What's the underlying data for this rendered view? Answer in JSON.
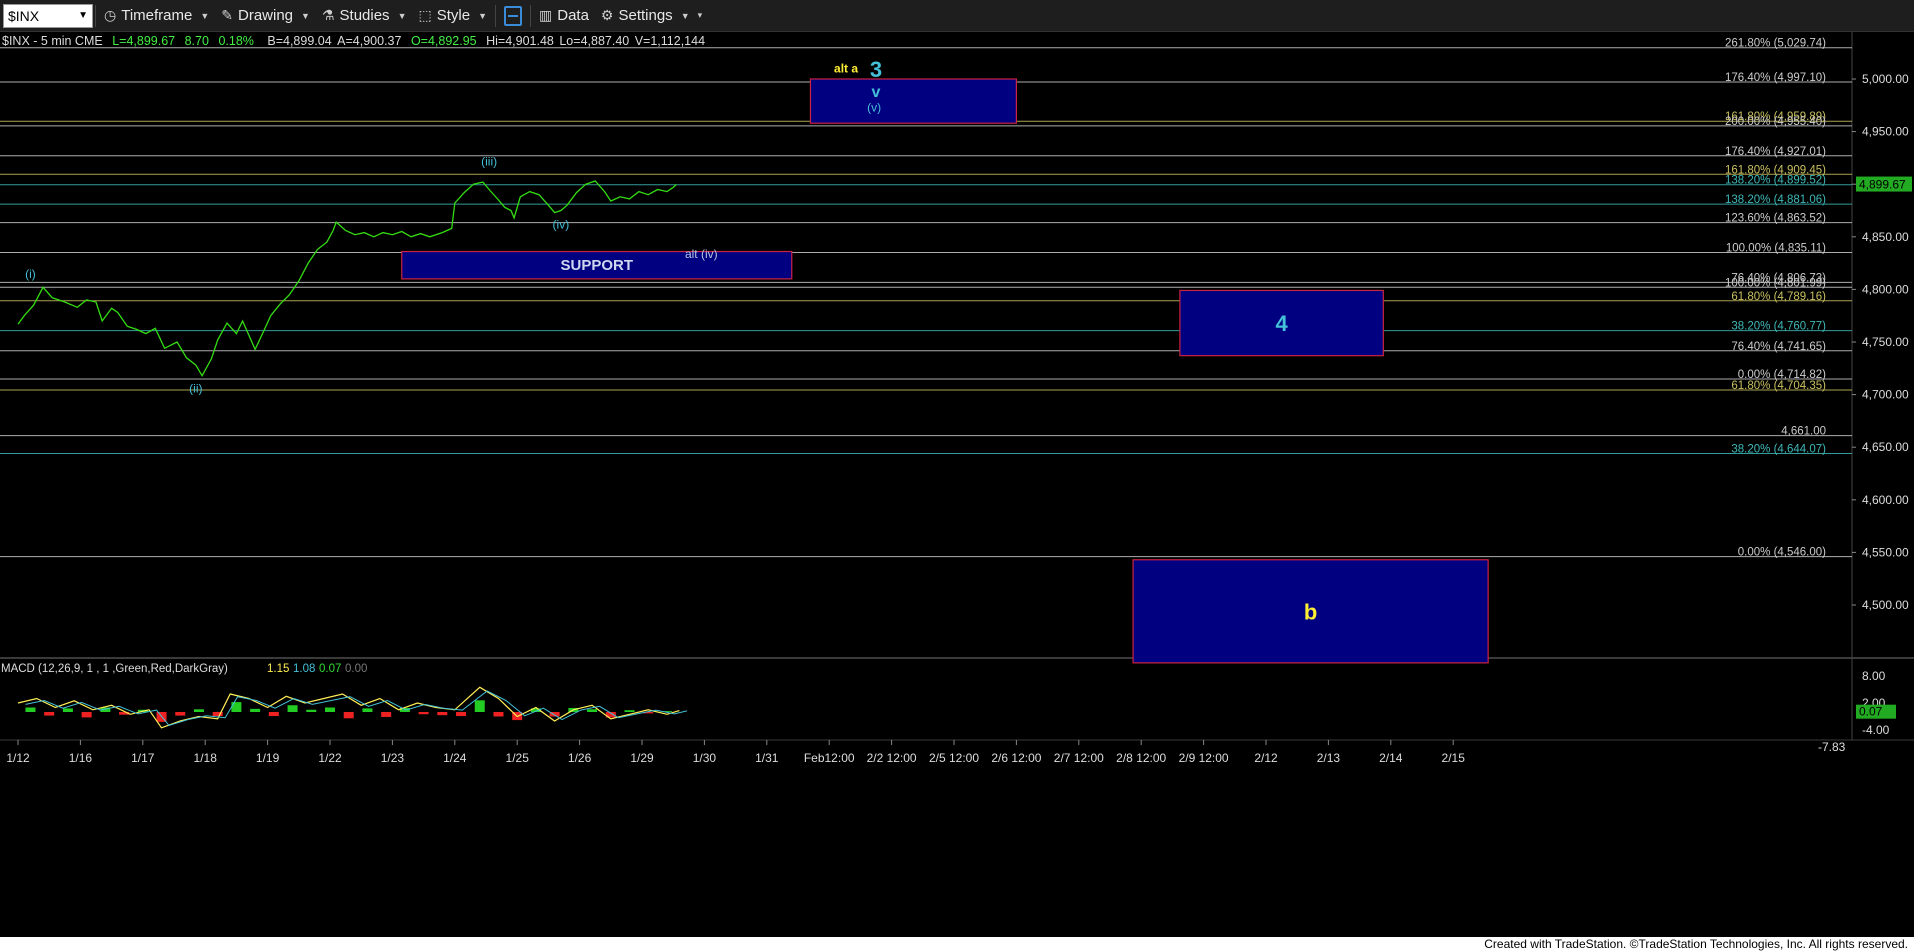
{
  "toolbar": {
    "symbol": "$INX",
    "items": [
      {
        "label": "Timeframe",
        "icon": "clock-icon"
      },
      {
        "label": "Drawing",
        "icon": "pencil-icon"
      },
      {
        "label": "Studies",
        "icon": "flask-icon"
      },
      {
        "label": "Style",
        "icon": "style-icon"
      },
      {
        "label": "Data",
        "icon": "bar-chart-icon"
      },
      {
        "label": "Settings",
        "icon": "gear-icon"
      }
    ]
  },
  "ticker_line": {
    "name": "$INX - 5 min  CME",
    "last": "L=4,899.67",
    "change": "8.70",
    "pct": "0.18%",
    "bid": "B=4,899.04",
    "ask": "A=4,900.37",
    "open": "O=4,892.95",
    "high": "Hi=4,901.48",
    "low": "Lo=4,887.40",
    "volume": "V=1,112,144"
  },
  "colors": {
    "background": "#000000",
    "price_line": "#33dd11",
    "box_fill": "#000080",
    "box_border": "#cc2244",
    "label_teal": "#44c0d8",
    "label_yellow": "#ffee33"
  },
  "chart_data": {
    "type": "line",
    "title": "$INX - 5 min",
    "price_axis": {
      "ylim": [
        4440,
        5040
      ],
      "ticks": [
        "5,000.00",
        "4,950.00",
        "4,900.00",
        "4,850.00",
        "4,800.00",
        "4,750.00",
        "4,700.00",
        "4,650.00",
        "4,600.00",
        "4,550.00",
        "4,500.00"
      ],
      "tick_values": [
        5000,
        4950,
        4900,
        4850,
        4800,
        4750,
        4700,
        4650,
        4600,
        4550,
        4500
      ]
    },
    "last_price": {
      "label": "4,899.67",
      "value": 4899.67
    },
    "x_ticks": [
      "1/12",
      "1/16",
      "1/17",
      "1/18",
      "1/19",
      "1/22",
      "1/23",
      "1/24",
      "1/25",
      "1/26",
      "1/29",
      "1/30",
      "1/31",
      "Feb12:00",
      "2/2 12:00",
      "2/5 12:00",
      "2/6 12:00",
      "2/7 12:00",
      "2/8 12:00",
      "2/9 12:00",
      "2/12",
      "2/13",
      "2/14",
      "2/15"
    ],
    "price_points": [
      [
        0,
        4767
      ],
      [
        0.1,
        4775
      ],
      [
        0.25,
        4785
      ],
      [
        0.4,
        4802
      ],
      [
        0.55,
        4792
      ],
      [
        0.75,
        4788
      ],
      [
        0.95,
        4783
      ],
      [
        1.1,
        4790
      ],
      [
        1.25,
        4788
      ],
      [
        1.35,
        4770
      ],
      [
        1.5,
        4782
      ],
      [
        1.6,
        4778
      ],
      [
        1.75,
        4765
      ],
      [
        1.9,
        4762
      ],
      [
        2.05,
        4758
      ],
      [
        2.2,
        4763
      ],
      [
        2.35,
        4744
      ],
      [
        2.55,
        4750
      ],
      [
        2.7,
        4735
      ],
      [
        2.85,
        4728
      ],
      [
        2.95,
        4718
      ],
      [
        3.1,
        4734
      ],
      [
        3.2,
        4752
      ],
      [
        3.35,
        4768
      ],
      [
        3.5,
        4758
      ],
      [
        3.6,
        4770
      ],
      [
        3.8,
        4743
      ],
      [
        3.95,
        4762
      ],
      [
        4.05,
        4775
      ],
      [
        4.2,
        4786
      ],
      [
        4.35,
        4795
      ],
      [
        4.5,
        4808
      ],
      [
        4.65,
        4825
      ],
      [
        4.8,
        4838
      ],
      [
        4.95,
        4845
      ],
      [
        5.05,
        4856
      ],
      [
        5.1,
        4864
      ],
      [
        5.25,
        4856
      ],
      [
        5.4,
        4852
      ],
      [
        5.55,
        4854
      ],
      [
        5.7,
        4850
      ],
      [
        5.85,
        4854
      ],
      [
        6.0,
        4852
      ],
      [
        6.15,
        4855
      ],
      [
        6.3,
        4850
      ],
      [
        6.45,
        4853
      ],
      [
        6.6,
        4850
      ],
      [
        6.8,
        4854
      ],
      [
        6.95,
        4858
      ],
      [
        7.0,
        4882
      ],
      [
        7.15,
        4892
      ],
      [
        7.3,
        4900
      ],
      [
        7.45,
        4902
      ],
      [
        7.55,
        4895
      ],
      [
        7.7,
        4885
      ],
      [
        7.8,
        4878
      ],
      [
        7.9,
        4875
      ],
      [
        7.95,
        4868
      ],
      [
        8.05,
        4888
      ],
      [
        8.2,
        4893
      ],
      [
        8.35,
        4890
      ],
      [
        8.5,
        4880
      ],
      [
        8.6,
        4873
      ],
      [
        8.7,
        4875
      ],
      [
        8.8,
        4880
      ],
      [
        8.95,
        4892
      ],
      [
        9.1,
        4900
      ],
      [
        9.25,
        4903
      ],
      [
        9.4,
        4893
      ],
      [
        9.5,
        4884
      ],
      [
        9.65,
        4888
      ],
      [
        9.8,
        4886
      ],
      [
        9.95,
        4893
      ],
      [
        10.1,
        4890
      ],
      [
        10.25,
        4895
      ],
      [
        10.4,
        4893
      ],
      [
        10.5,
        4897
      ],
      [
        10.55,
        4899.67
      ]
    ],
    "wave_labels": [
      {
        "text": "(i)",
        "x": 0.2,
        "y": 4811,
        "color": "#44c0d8"
      },
      {
        "text": "(ii)",
        "x": 2.85,
        "y": 4702,
        "color": "#44c0d8"
      },
      {
        "text": "(iii)",
        "x": 7.55,
        "y": 4918,
        "color": "#44c0d8"
      },
      {
        "text": "(iv)",
        "x": 8.7,
        "y": 4858,
        "color": "#44c0d8"
      },
      {
        "text": "alt (iv)",
        "x": 10.95,
        "y": 4830,
        "color": "#b8c8e0"
      },
      {
        "text": "alt a",
        "x": 13.27,
        "y": 5006,
        "color": "#ffee33"
      },
      {
        "text": "3",
        "x": 13.75,
        "y": 5002,
        "color": "#44c0d8"
      },
      {
        "text": "v",
        "x": 13.75,
        "y": 4983,
        "color": "#44c0d8"
      },
      {
        "text": "(v)",
        "x": 13.72,
        "y": 4969,
        "color": "#44c0d8"
      }
    ],
    "fib_levels": [
      {
        "label": "261.80% (5,029.74)",
        "value": 5029.74,
        "color": "#cccccc"
      },
      {
        "label": "176.40% (4,997.10)",
        "value": 4997.1,
        "color": "#cccccc"
      },
      {
        "label": "161.80% (4,959.89)",
        "value": 4959.89,
        "color": "#c8c060"
      },
      {
        "label": "200.00% (4,955.40)",
        "value": 4955.4,
        "color": "#cccccc"
      },
      {
        "label": "176.40% (4,927.01)",
        "value": 4927.01,
        "color": "#cccccc"
      },
      {
        "label": "161.80% (4,909.45)",
        "value": 4909.45,
        "color": "#c8c060"
      },
      {
        "label": "138.20% (4,899.52)",
        "value": 4899.52,
        "color": "#3fb8b8"
      },
      {
        "label": "138.20% (4,881.06)",
        "value": 4881.06,
        "color": "#3fb8b8"
      },
      {
        "label": "123.60% (4,863.52)",
        "value": 4863.52,
        "color": "#cccccc"
      },
      {
        "label": "100.00% (4,835.11)",
        "value": 4835.11,
        "color": "#cccccc"
      },
      {
        "label": "76.40% (4,806.73)",
        "value": 4806.73,
        "color": "#cccccc"
      },
      {
        "label": "100.00% (4,801.99)",
        "value": 4801.99,
        "color": "#cccccc"
      },
      {
        "label": "61.80% (4,789.16)",
        "value": 4789.16,
        "color": "#c8c060"
      },
      {
        "label": "38.20% (4,760.77)",
        "value": 4760.77,
        "color": "#3fb8b8"
      },
      {
        "label": "76.40% (4,741.65)",
        "value": 4741.65,
        "color": "#cccccc"
      },
      {
        "label": "0.00% (4,714.82)",
        "value": 4714.82,
        "color": "#cccccc"
      },
      {
        "label": "61.80% (4,704.35)",
        "value": 4704.35,
        "color": "#c8c060"
      },
      {
        "label": "4,661.00",
        "value": 4661.0,
        "color": "#cccccc"
      },
      {
        "label": "38.20% (4,644.07)",
        "value": 4644.07,
        "color": "#3fb8b8"
      },
      {
        "label": "0.00% (4,546.00)",
        "value": 4546.0,
        "color": "#cccccc"
      }
    ],
    "zones": [
      {
        "label": "",
        "x0": 12.7,
        "x1": 16.0,
        "y0": 4958,
        "y1": 5000
      },
      {
        "label": "SUPPORT",
        "x0": 6.15,
        "x1": 12.4,
        "y0": 4810,
        "y1": 4836,
        "label_color": "#cfd8f0"
      },
      {
        "label": "4",
        "x0": 18.62,
        "x1": 21.88,
        "y0": 4737,
        "y1": 4799,
        "label_color": "#44c0d8"
      },
      {
        "label": "b",
        "x0": 17.87,
        "x1": 23.56,
        "y0": 4445,
        "y1": 4543,
        "label_color": "#ffee33"
      }
    ],
    "macd": {
      "title": "MACD (12,26,9, 1 , 1 ,Green,Red,DarkGray)",
      "values": [
        "1.15",
        "1.08",
        "0.07",
        "0.00"
      ],
      "value_colors": [
        "#ffee55",
        "#44c0d8",
        "#33dd33",
        "#777777"
      ],
      "ylim": [
        -7.83,
        8.0
      ],
      "ticks": [
        "8.00",
        "2.00",
        "-4.00",
        "-7.83"
      ],
      "tick_values": [
        8.0,
        2.0,
        -4.0,
        -7.83
      ],
      "last_label": "0.07",
      "last_value": 0.07,
      "line_points": [
        [
          0,
          2
        ],
        [
          0.3,
          3
        ],
        [
          0.6,
          1
        ],
        [
          0.9,
          2.5
        ],
        [
          1.2,
          0.5
        ],
        [
          1.5,
          1.5
        ],
        [
          1.8,
          -0.5
        ],
        [
          2.1,
          0.5
        ],
        [
          2.3,
          -3.5
        ],
        [
          2.6,
          -2
        ],
        [
          2.9,
          -1
        ],
        [
          3.2,
          -1.5
        ],
        [
          3.4,
          4
        ],
        [
          3.7,
          3
        ],
        [
          4.0,
          1
        ],
        [
          4.3,
          3.5
        ],
        [
          4.6,
          2
        ],
        [
          4.9,
          3
        ],
        [
          5.2,
          4
        ],
        [
          5.5,
          1.5
        ],
        [
          5.8,
          3
        ],
        [
          6.1,
          0.5
        ],
        [
          6.4,
          2
        ],
        [
          6.7,
          1
        ],
        [
          7.0,
          0.5
        ],
        [
          7.4,
          5.5
        ],
        [
          7.7,
          3
        ],
        [
          8.0,
          -1
        ],
        [
          8.3,
          1
        ],
        [
          8.6,
          -2
        ],
        [
          8.9,
          0.5
        ],
        [
          9.2,
          1.5
        ],
        [
          9.5,
          -1.5
        ],
        [
          9.8,
          -0.5
        ],
        [
          10.1,
          0.5
        ],
        [
          10.4,
          -0.5
        ],
        [
          10.6,
          0.3
        ]
      ],
      "hist": [
        [
          0.2,
          1
        ],
        [
          0.5,
          -0.8
        ],
        [
          0.8,
          0.8
        ],
        [
          1.1,
          -1.2
        ],
        [
          1.4,
          1
        ],
        [
          1.7,
          -0.6
        ],
        [
          2.0,
          0.5
        ],
        [
          2.3,
          -2.2
        ],
        [
          2.6,
          -0.8
        ],
        [
          2.9,
          0.6
        ],
        [
          3.2,
          -0.9
        ],
        [
          3.5,
          2.2
        ],
        [
          3.8,
          0.7
        ],
        [
          4.1,
          -0.9
        ],
        [
          4.4,
          1.5
        ],
        [
          4.7,
          0.5
        ],
        [
          5.0,
          1
        ],
        [
          5.3,
          -1.4
        ],
        [
          5.6,
          0.8
        ],
        [
          5.9,
          -1.1
        ],
        [
          6.2,
          0.9
        ],
        [
          6.5,
          -0.5
        ],
        [
          6.8,
          -0.7
        ],
        [
          7.1,
          -0.9
        ],
        [
          7.4,
          2.6
        ],
        [
          7.7,
          -1
        ],
        [
          8.0,
          -1.8
        ],
        [
          8.3,
          0.8
        ],
        [
          8.6,
          -1
        ],
        [
          8.9,
          0.9
        ],
        [
          9.2,
          0.6
        ],
        [
          9.5,
          -1.2
        ],
        [
          9.8,
          0.4
        ],
        [
          10.1,
          -0.3
        ],
        [
          10.4,
          0.2
        ]
      ]
    }
  },
  "footer": {
    "text": "Created with TradeStation. ©TradeStation Technologies, Inc. All rights reserved."
  }
}
